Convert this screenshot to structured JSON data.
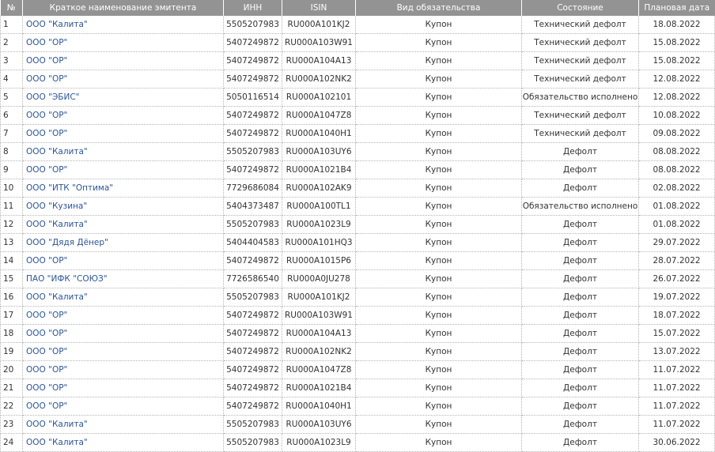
{
  "table": {
    "headers": [
      "№",
      "Краткое наименование эмитента",
      "ИНН",
      "ISIN",
      "Вид обязательства",
      "Состояние",
      "Плановая дата"
    ],
    "rows": [
      [
        "1",
        "ООО \"Калита\"",
        "5505207983",
        "RU000A101KJ2",
        "Купон",
        "Технический дефолт",
        "18.08.2022"
      ],
      [
        "2",
        "ООО \"ОР\"",
        "5407249872",
        "RU000A103W91",
        "Купон",
        "Технический дефолт",
        "15.08.2022"
      ],
      [
        "3",
        "ООО \"ОР\"",
        "5407249872",
        "RU000A104A13",
        "Купон",
        "Технический дефолт",
        "15.08.2022"
      ],
      [
        "4",
        "ООО \"ОР\"",
        "5407249872",
        "RU000A102NK2",
        "Купон",
        "Технический дефолт",
        "12.08.2022"
      ],
      [
        "5",
        "ООО \"ЭБИС\"",
        "5050116514",
        "RU000A102101",
        "Купон",
        "Обязательство исполнено",
        "12.08.2022"
      ],
      [
        "6",
        "ООО \"ОР\"",
        "5407249872",
        "RU000A1047Z8",
        "Купон",
        "Технический дефолт",
        "10.08.2022"
      ],
      [
        "7",
        "ООО \"ОР\"",
        "5407249872",
        "RU000A1040H1",
        "Купон",
        "Технический дефолт",
        "09.08.2022"
      ],
      [
        "8",
        "ООО \"Калита\"",
        "5505207983",
        "RU000A103UY6",
        "Купон",
        "Дефолт",
        "08.08.2022"
      ],
      [
        "9",
        "ООО \"ОР\"",
        "5407249872",
        "RU000A1021B4",
        "Купон",
        "Дефолт",
        "08.08.2022"
      ],
      [
        "10",
        "ООО \"ИТК \"Оптима\"",
        "7729686084",
        "RU000A102AK9",
        "Купон",
        "Дефолт",
        "02.08.2022"
      ],
      [
        "11",
        "ООО \"Кузина\"",
        "5404373487",
        "RU000A100TL1",
        "Купон",
        "Обязательство исполнено",
        "01.08.2022"
      ],
      [
        "12",
        "ООО \"Калита\"",
        "5505207983",
        "RU000A1023L9",
        "Купон",
        "Дефолт",
        "01.08.2022"
      ],
      [
        "13",
        "ООО \"Дядя Дёнер\"",
        "5404404583",
        "RU000A101HQ3",
        "Купон",
        "Дефолт",
        "29.07.2022"
      ],
      [
        "14",
        "ООО \"ОР\"",
        "5407249872",
        "RU000A1015P6",
        "Купон",
        "Дефолт",
        "28.07.2022"
      ],
      [
        "15",
        "ПАО \"ИФК \"СОЮЗ\"",
        "7726586540",
        "RU000A0JU278",
        "Купон",
        "Дефолт",
        "26.07.2022"
      ],
      [
        "16",
        "ООО \"Калита\"",
        "5505207983",
        "RU000A101KJ2",
        "Купон",
        "Дефолт",
        "19.07.2022"
      ],
      [
        "17",
        "ООО \"ОР\"",
        "5407249872",
        "RU000A103W91",
        "Купон",
        "Дефолт",
        "18.07.2022"
      ],
      [
        "18",
        "ООО \"ОР\"",
        "5407249872",
        "RU000A104A13",
        "Купон",
        "Дефолт",
        "15.07.2022"
      ],
      [
        "19",
        "ООО \"ОР\"",
        "5407249872",
        "RU000A102NK2",
        "Купон",
        "Дефолт",
        "13.07.2022"
      ],
      [
        "20",
        "ООО \"ОР\"",
        "5407249872",
        "RU000A1047Z8",
        "Купон",
        "Дефолт",
        "11.07.2022"
      ],
      [
        "21",
        "ООО \"ОР\"",
        "5407249872",
        "RU000A1021B4",
        "Купон",
        "Дефолт",
        "11.07.2022"
      ],
      [
        "22",
        "ООО \"ОР\"",
        "5407249872",
        "RU000A1040H1",
        "Купон",
        "Дефолт",
        "11.07.2022"
      ],
      [
        "23",
        "ООО \"Калита\"",
        "5505207983",
        "RU000A103UY6",
        "Купон",
        "Дефолт",
        "11.07.2022"
      ],
      [
        "24",
        "ООО \"Калита\"",
        "5505207983",
        "RU000A1023L9",
        "Купон",
        "Дефолт",
        "30.06.2022"
      ]
    ]
  },
  "colors": {
    "header_bg": "#939393",
    "header_text": "#ffffff",
    "link": "#2a5597",
    "text": "#333333"
  }
}
